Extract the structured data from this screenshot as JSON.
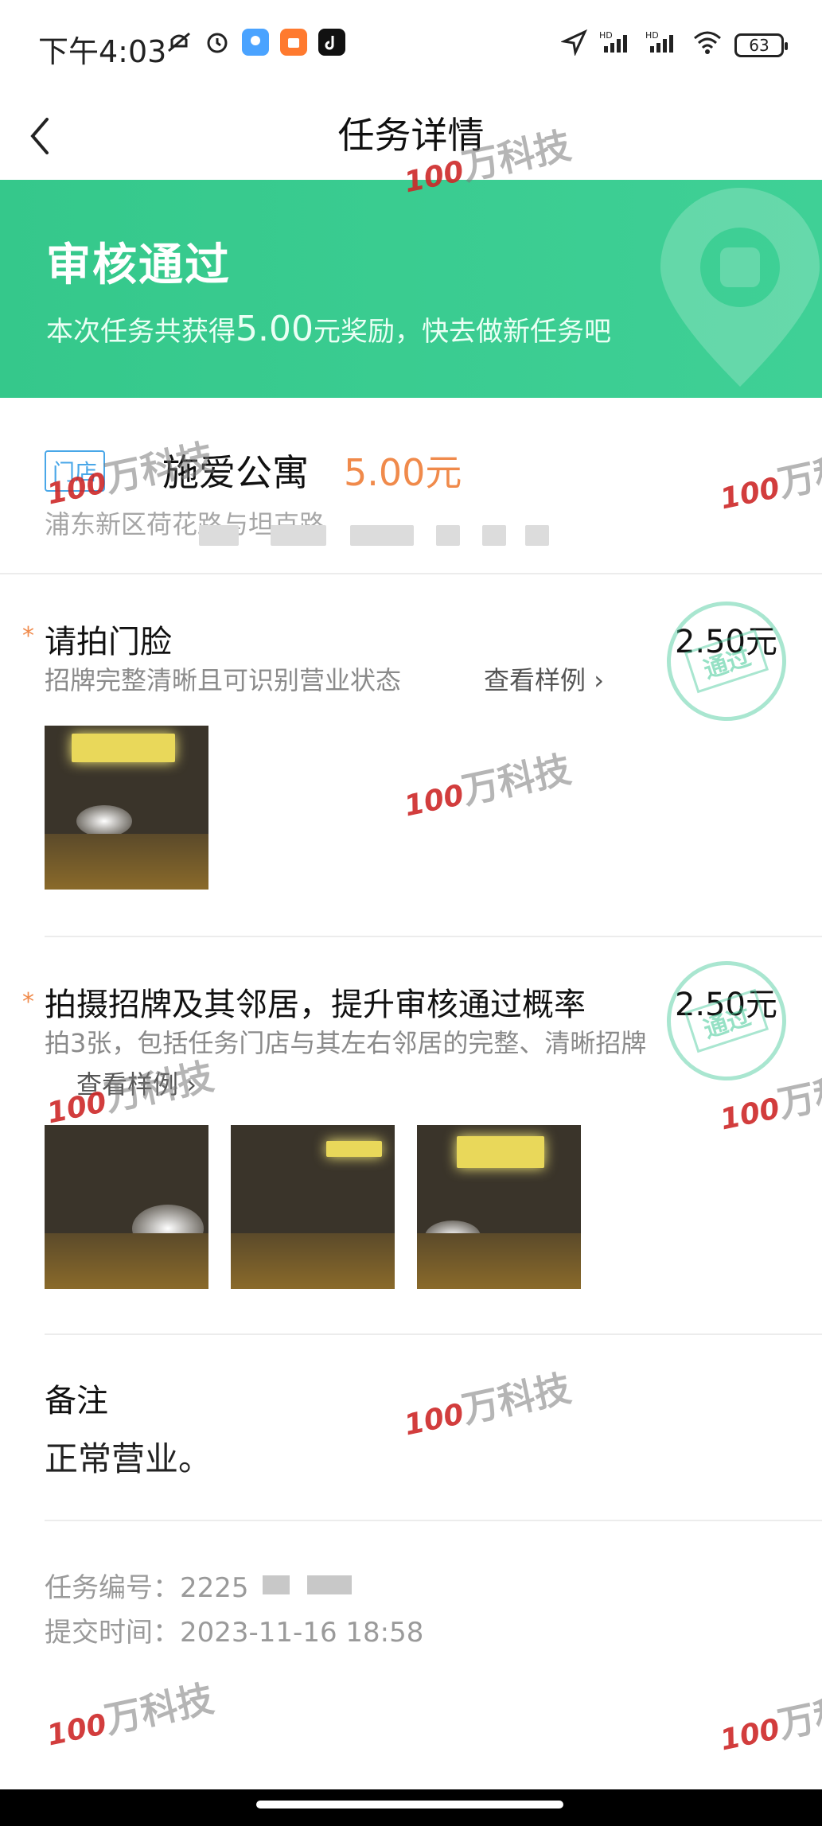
{
  "status_bar": {
    "time": "下午4:03",
    "battery": "63",
    "network": "HD"
  },
  "nav": {
    "title": "任务详情",
    "back_icon": "chevron-left-icon"
  },
  "banner": {
    "title": "审核通过",
    "sub_prefix": "本次任务共获得",
    "sub_amount": "5.00",
    "sub_suffix": "元奖励，快去做新任务吧",
    "bg_color": "#3fd096"
  },
  "store": {
    "tag": "门店",
    "name": "施爱公寓",
    "price": "5.00元",
    "address": "浦东新区荷花路与坦克路"
  },
  "tasks": [
    {
      "title": "请拍门脸",
      "price": "2.50元",
      "desc": "招牌完整清晰且可识别营业状态",
      "sample_link": "查看样例",
      "stamp": "通过"
    },
    {
      "title": "拍摄招牌及其邻居，提升审核通过概率",
      "price": "2.50元",
      "desc": "拍3张，包括任务门店与其左右邻居的完整、清晰招牌",
      "sample_link": "查看样例",
      "stamp": "通过"
    }
  ],
  "notes": {
    "label": "备注",
    "text": "正常营业。"
  },
  "meta": {
    "task_id_label": "任务编号：",
    "task_id_value": "2225",
    "submit_time_label": "提交时间：",
    "submit_time_value": "2023-11-16 18:58"
  },
  "watermark": {
    "num": "100",
    "text": "万科技"
  },
  "colors": {
    "accent_green": "#35c88b",
    "price_orange": "#f08a4b",
    "tag_blue": "#49a7e8"
  }
}
